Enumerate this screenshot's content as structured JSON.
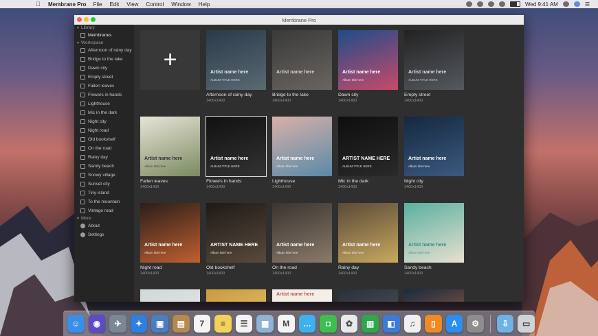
{
  "menubar": {
    "apple_icon": "apple-icon",
    "app_name": "Membrane Pro",
    "menus": [
      "File",
      "Edit",
      "View",
      "Control",
      "Window",
      "Help"
    ],
    "clock": "Wed 9:41 AM"
  },
  "window": {
    "title": "Membrane Pro"
  },
  "sidebar": {
    "library_label": "Library",
    "membranes_label": "Membranes",
    "workspace_label": "Workspace",
    "workspace_items": [
      "Afternoon of rainy day",
      "Bridge to the lake",
      "Dawn city",
      "Empty street",
      "Fallen leaves",
      "Flowers in hands",
      "Lighthouse",
      "Mic in the dark",
      "Night city",
      "Night road",
      "Old bookshelf",
      "On the road",
      "Rainy day",
      "Sandy beach",
      "Snowy village",
      "Sunset city",
      "Tiny island",
      "To the mountain",
      "Vintage road"
    ],
    "more_label": "More",
    "about_label": "About",
    "settings_label": "Settings"
  },
  "grid": {
    "add_label": "+",
    "tiles": [
      {
        "name": "Afternoon of rainy day",
        "size": "1400x1400",
        "overlay": "Artist name here",
        "sub": "ALBUM TITLE HERE"
      },
      {
        "name": "Bridge to the lake",
        "size": "1400x1400",
        "overlay": "Artist name here",
        "sub": ""
      },
      {
        "name": "Dawn city",
        "size": "1400x1400",
        "overlay": "Artist name here",
        "sub": "Album title here"
      },
      {
        "name": "Empty street",
        "size": "1400x1400",
        "overlay": "Artist name here",
        "sub": "ALBUM TITLE HERE"
      },
      {
        "name": "Fallen leaves",
        "size": "1400x1400",
        "overlay": "Artist name here",
        "sub": "Album title here"
      },
      {
        "name": "Flowers in hands",
        "size": "1400x1400",
        "overlay": "Artist name here",
        "sub": "ALBUM TITLE HERE"
      },
      {
        "name": "Lighthouse",
        "size": "1400x1400",
        "overlay": "Artist name here",
        "sub": "Album title here"
      },
      {
        "name": "Mic in the dark",
        "size": "1400x1400",
        "overlay": "ARTIST NAME HERE",
        "sub": "ALBUM TITLE HERE"
      },
      {
        "name": "Night city",
        "size": "1400x1400",
        "overlay": "Artist name here",
        "sub": "Album title here"
      },
      {
        "name": "Night road",
        "size": "1400x1400",
        "overlay": "Artist name here",
        "sub": "Album title here"
      },
      {
        "name": "Old bookshelf",
        "size": "1400x1400",
        "overlay": "ARTIST NAME HERE",
        "sub": "Album title here"
      },
      {
        "name": "On the road",
        "size": "1400x1400",
        "overlay": "Artist name here",
        "sub": "Album title here"
      },
      {
        "name": "Rainy day",
        "size": "1400x1400",
        "overlay": "Artist name here",
        "sub": "Album title here"
      },
      {
        "name": "Sandy beach",
        "size": "1400x1400",
        "overlay": "Artist name here",
        "sub": "Album title here"
      },
      {
        "name": "",
        "size": "",
        "overlay": "",
        "sub": ""
      },
      {
        "name": "",
        "size": "",
        "overlay": "",
        "sub": ""
      },
      {
        "name": "",
        "size": "",
        "overlay": "Artist name here",
        "sub": ""
      },
      {
        "name": "",
        "size": "",
        "overlay": "",
        "sub": ""
      },
      {
        "name": "",
        "size": "",
        "overlay": "",
        "sub": ""
      }
    ]
  },
  "dock": {
    "apps": [
      {
        "icon": "finder-icon",
        "color": "#3b8ee8",
        "glyph": "☺"
      },
      {
        "icon": "siri-icon",
        "color": "#5b4bc4",
        "glyph": "◉"
      },
      {
        "icon": "launchpad-icon",
        "color": "#7a8896",
        "glyph": "✈"
      },
      {
        "icon": "safari-icon",
        "color": "#2f7fe0",
        "glyph": "✦"
      },
      {
        "icon": "photo-app-icon",
        "color": "#4a7fbf",
        "glyph": "▣"
      },
      {
        "icon": "contacts-icon",
        "color": "#b48a4e",
        "glyph": "▤"
      },
      {
        "icon": "calendar-icon",
        "color": "#f4f4f4",
        "glyph": "7"
      },
      {
        "icon": "notes-icon",
        "color": "#f2d35a",
        "glyph": "≡"
      },
      {
        "icon": "reminders-icon",
        "color": "#f4f4f4",
        "glyph": "☰"
      },
      {
        "icon": "preview-icon",
        "color": "#8fb2d6",
        "glyph": "▦"
      },
      {
        "icon": "membrane-icon",
        "color": "#f4f4f4",
        "glyph": "M"
      },
      {
        "icon": "messages-icon",
        "color": "#3fb0ee",
        "glyph": "…"
      },
      {
        "icon": "facetime-icon",
        "color": "#3cbf4e",
        "glyph": "◘"
      },
      {
        "icon": "photos-icon",
        "color": "#e9e9e9",
        "glyph": "✿"
      },
      {
        "icon": "numbers-icon",
        "color": "#2ea84a",
        "glyph": "▥"
      },
      {
        "icon": "keynote-icon",
        "color": "#3b7cd6",
        "glyph": "◧"
      },
      {
        "icon": "itunes-icon",
        "color": "#f0f0f0",
        "glyph": "♫"
      },
      {
        "icon": "ibooks-icon",
        "color": "#f08a24",
        "glyph": "▯"
      },
      {
        "icon": "app-store-icon",
        "color": "#2b8ef0",
        "glyph": "A"
      },
      {
        "icon": "system-preferences-icon",
        "color": "#8d8d8d",
        "glyph": "⚙"
      }
    ],
    "trail": [
      {
        "icon": "downloads-folder-icon",
        "color": "#6fb2e8",
        "glyph": "⇩"
      },
      {
        "icon": "trash-icon",
        "color": "#cfd3d8",
        "glyph": "▭"
      }
    ]
  }
}
